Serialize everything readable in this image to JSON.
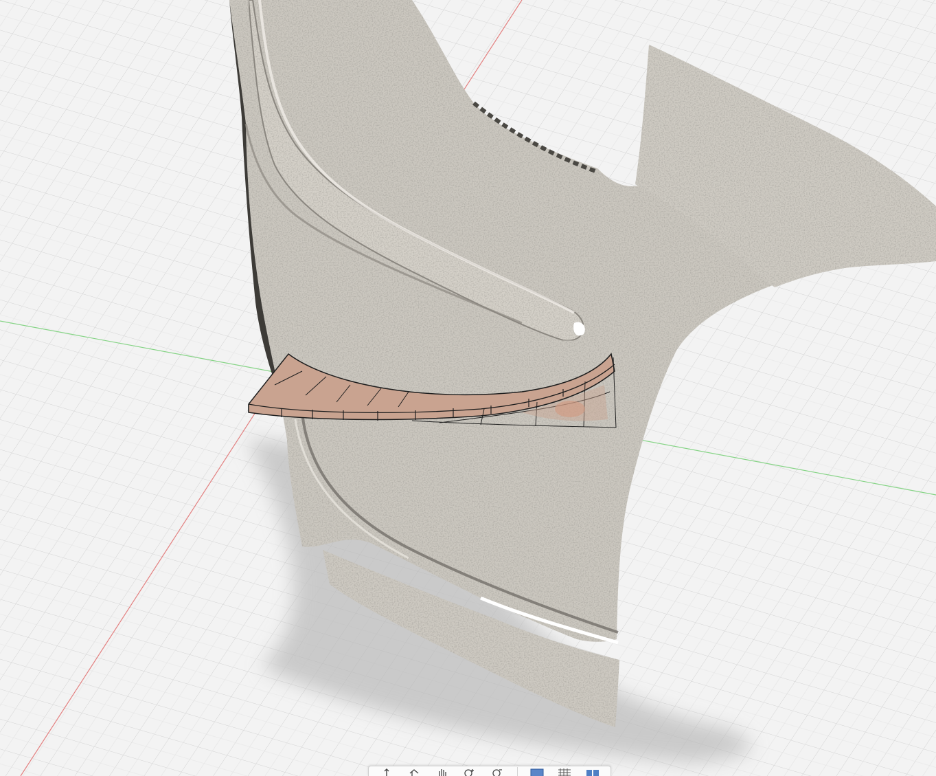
{
  "viewport": {
    "background": "#f3f3f3",
    "grid_color": "#d0d0d0",
    "axis_x_color": "#e07070",
    "axis_y_color": "#7fd07f",
    "mesh_fill": "#c9c5bd",
    "mesh_wire": "#6e6b65",
    "surface_fill": "#c9a390",
    "surface_edge": "#1e1e1e"
  },
  "navbar": {
    "tools": [
      {
        "name": "orbit-icon"
      },
      {
        "name": "look-at-icon"
      },
      {
        "name": "pan-icon"
      },
      {
        "name": "zoom-icon"
      },
      {
        "name": "fit-icon"
      },
      {
        "name": "display-settings-icon"
      },
      {
        "name": "grid-settings-icon"
      },
      {
        "name": "viewports-icon"
      }
    ]
  }
}
